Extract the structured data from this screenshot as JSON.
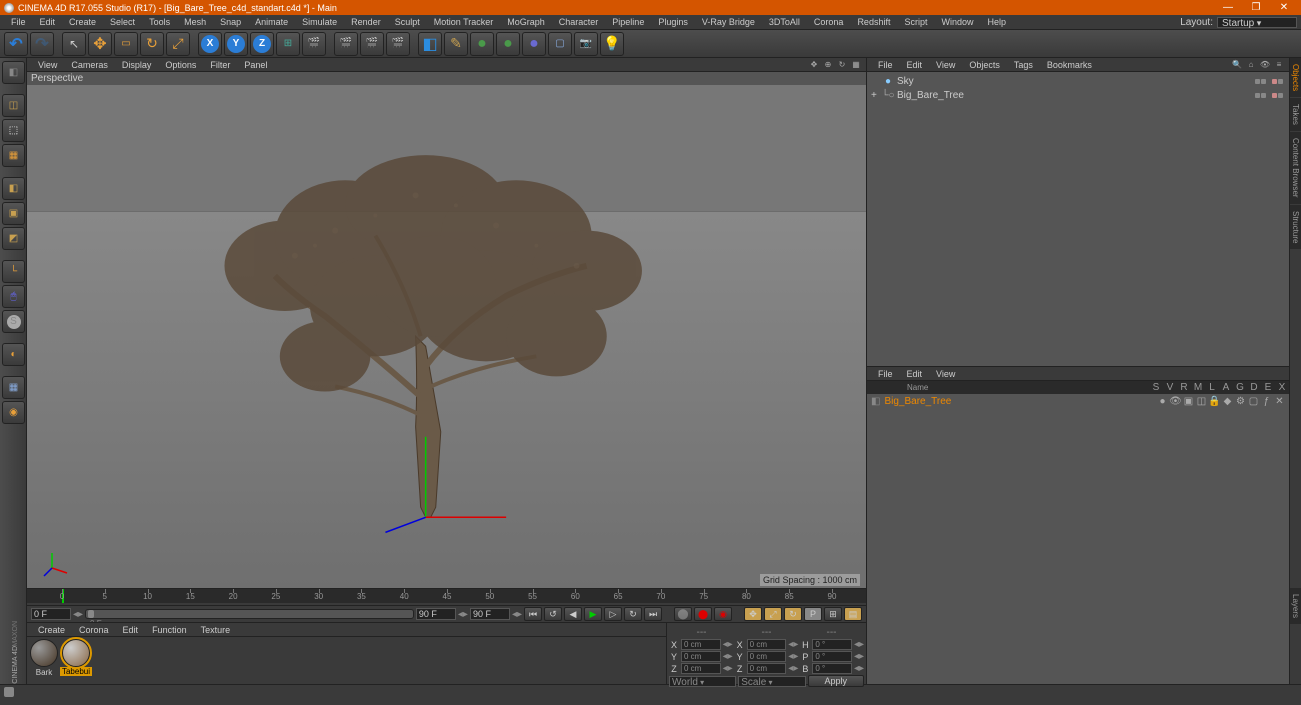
{
  "titlebar": {
    "title": "CINEMA 4D R17.055 Studio (R17) - [Big_Bare_Tree_c4d_standart.c4d *] - Main"
  },
  "menubar": {
    "items": [
      "File",
      "Edit",
      "Create",
      "Select",
      "Tools",
      "Mesh",
      "Snap",
      "Animate",
      "Simulate",
      "Render",
      "Sculpt",
      "Motion Tracker",
      "MoGraph",
      "Character",
      "Pipeline",
      "Plugins",
      "V-Ray Bridge",
      "3DToAll",
      "Corona",
      "Redshift",
      "Script",
      "Window",
      "Help"
    ],
    "layout_label": "Layout:",
    "layout_value": "Startup"
  },
  "viewport": {
    "menu": [
      "View",
      "Cameras",
      "Display",
      "Options",
      "Filter",
      "Panel"
    ],
    "label": "Perspective",
    "grid_spacing": "Grid Spacing : 1000 cm"
  },
  "timeline": {
    "ticks": [
      "0",
      "5",
      "10",
      "15",
      "20",
      "25",
      "30",
      "35",
      "40",
      "45",
      "50",
      "55",
      "60",
      "65",
      "70",
      "75",
      "80",
      "85",
      "90"
    ],
    "start": "0 F",
    "current": "0 F",
    "end": "90 F",
    "end2": "90 F"
  },
  "materials": {
    "menu": [
      "Create",
      "Corona",
      "Edit",
      "Function",
      "Texture"
    ],
    "items": [
      {
        "name": "Bark"
      },
      {
        "name": "Tabebui"
      }
    ]
  },
  "coords": {
    "X": "0 cm",
    "Y": "0 cm",
    "Z": "0 cm",
    "sX": "0 cm",
    "sY": "0 cm",
    "sZ": "0 cm",
    "H": "0 °",
    "P": "0 °",
    "B": "0 °",
    "mode1": "World",
    "mode2": "Scale",
    "apply": "Apply"
  },
  "objects": {
    "menu": [
      "File",
      "Edit",
      "View",
      "Objects",
      "Tags",
      "Bookmarks"
    ],
    "tree": [
      {
        "name": "Sky",
        "icon": "sky",
        "indent": 0,
        "expand": ""
      },
      {
        "name": "Big_Bare_Tree",
        "icon": "null",
        "indent": 0,
        "expand": "+"
      }
    ]
  },
  "attributes": {
    "menu": [
      "File",
      "Edit",
      "View"
    ],
    "cols": [
      "",
      "Name",
      "S",
      "V",
      "R",
      "M",
      "L",
      "A",
      "G",
      "D",
      "E",
      "X"
    ],
    "rows": [
      {
        "name": "Big_Bare_Tree"
      }
    ]
  },
  "right_tabs": [
    "Objects",
    "Takes",
    "Content Browser",
    "Structure"
  ],
  "right_tabs2": [
    "Layers"
  ],
  "toolbar_icons": {
    "x_axis": "X",
    "y_axis": "Y",
    "z_axis": "Z"
  }
}
